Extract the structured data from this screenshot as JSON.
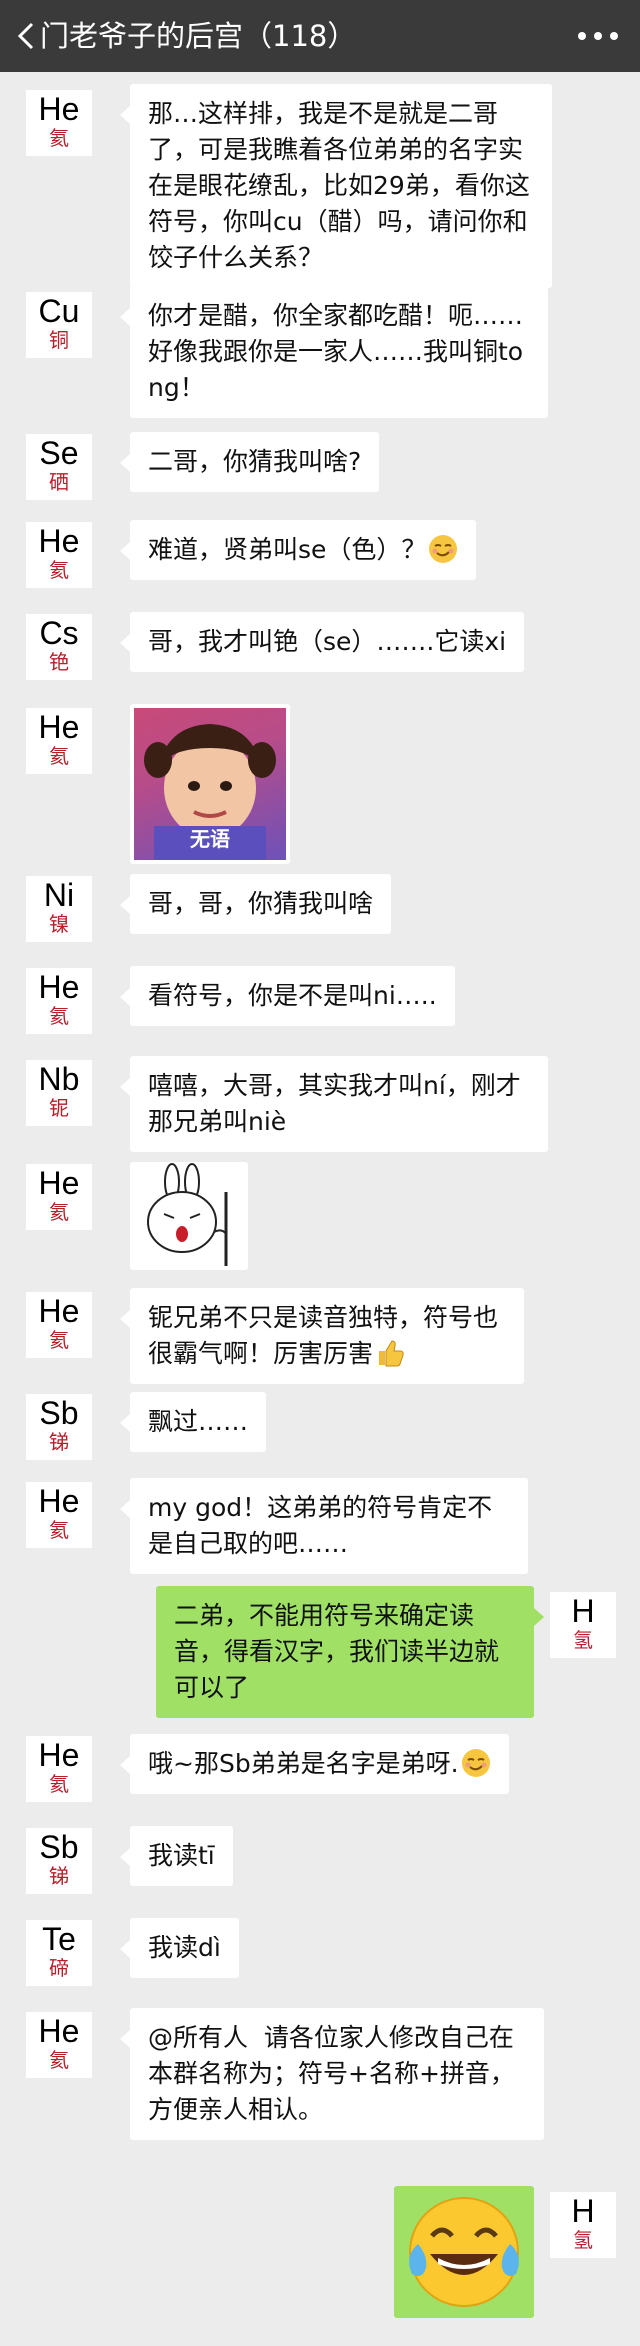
{
  "header": {
    "title": "门老爷子的后宫（118）"
  },
  "messages": [
    {
      "side": "left",
      "symbol": "He",
      "name": "氦",
      "text": "那…这样排，我是不是就是二哥了，可是我瞧着各位弟弟的名字实在是眼花缭乱，比如29弟，看你这符号，你叫cu（醋）吗，请问你和饺子什么关系？"
    },
    {
      "side": "left",
      "symbol": "Cu",
      "name": "铜",
      "text": "你才是醋，你全家都吃醋！呃……好像我跟你是一家人……我叫铜tong！"
    },
    {
      "side": "left",
      "symbol": "Se",
      "name": "硒",
      "text": "二哥，你猜我叫啥?"
    },
    {
      "side": "left",
      "symbol": "He",
      "name": "氦",
      "text": "难道，贤弟叫se（色）？"
    },
    {
      "side": "left",
      "symbol": "Cs",
      "name": "铯",
      "text": "哥，我才叫铯（se）…….它读xi"
    },
    {
      "side": "left",
      "symbol": "He",
      "name": "氦",
      "image_caption": "无语"
    },
    {
      "side": "left",
      "symbol": "Ni",
      "name": "镍",
      "text": "哥，哥，你猜我叫啥"
    },
    {
      "side": "left",
      "symbol": "He",
      "name": "氦",
      "text": "看符号，你是不是叫ni….."
    },
    {
      "side": "left",
      "symbol": "Nb",
      "name": "铌",
      "text": "嘻嘻，大哥，其实我才叫ní，刚才那兄弟叫niè"
    },
    {
      "side": "left",
      "symbol": "He",
      "name": "氦"
    },
    {
      "side": "left",
      "symbol": "He",
      "name": "氦",
      "text": "铌兄弟不只是读音独特，符号也很霸气啊！厉害厉害"
    },
    {
      "side": "left",
      "symbol": "Sb",
      "name": "锑",
      "text": "飘过……"
    },
    {
      "side": "left",
      "symbol": "He",
      "name": "氦",
      "text": "my god！这弟弟的符号肯定不是自己取的吧……"
    },
    {
      "side": "right",
      "symbol": "H",
      "name": "氢",
      "text": "二弟，不能用符号来确定读音，得看汉字，我们读半边就可以了"
    },
    {
      "side": "left",
      "symbol": "He",
      "name": "氦",
      "text": "哦~那Sb弟弟是名字是弟呀."
    },
    {
      "side": "left",
      "symbol": "Sb",
      "name": "锑",
      "text": "我读tī"
    },
    {
      "side": "left",
      "symbol": "Te",
      "name": "碲",
      "text": "我读dì"
    },
    {
      "side": "left",
      "symbol": "He",
      "name": "氦",
      "text": "@所有人  请各位家人修改自己在本群名称为；符号+名称+拼音，方便亲人相认。"
    },
    {
      "side": "right",
      "symbol": "H",
      "name": "氢"
    }
  ]
}
